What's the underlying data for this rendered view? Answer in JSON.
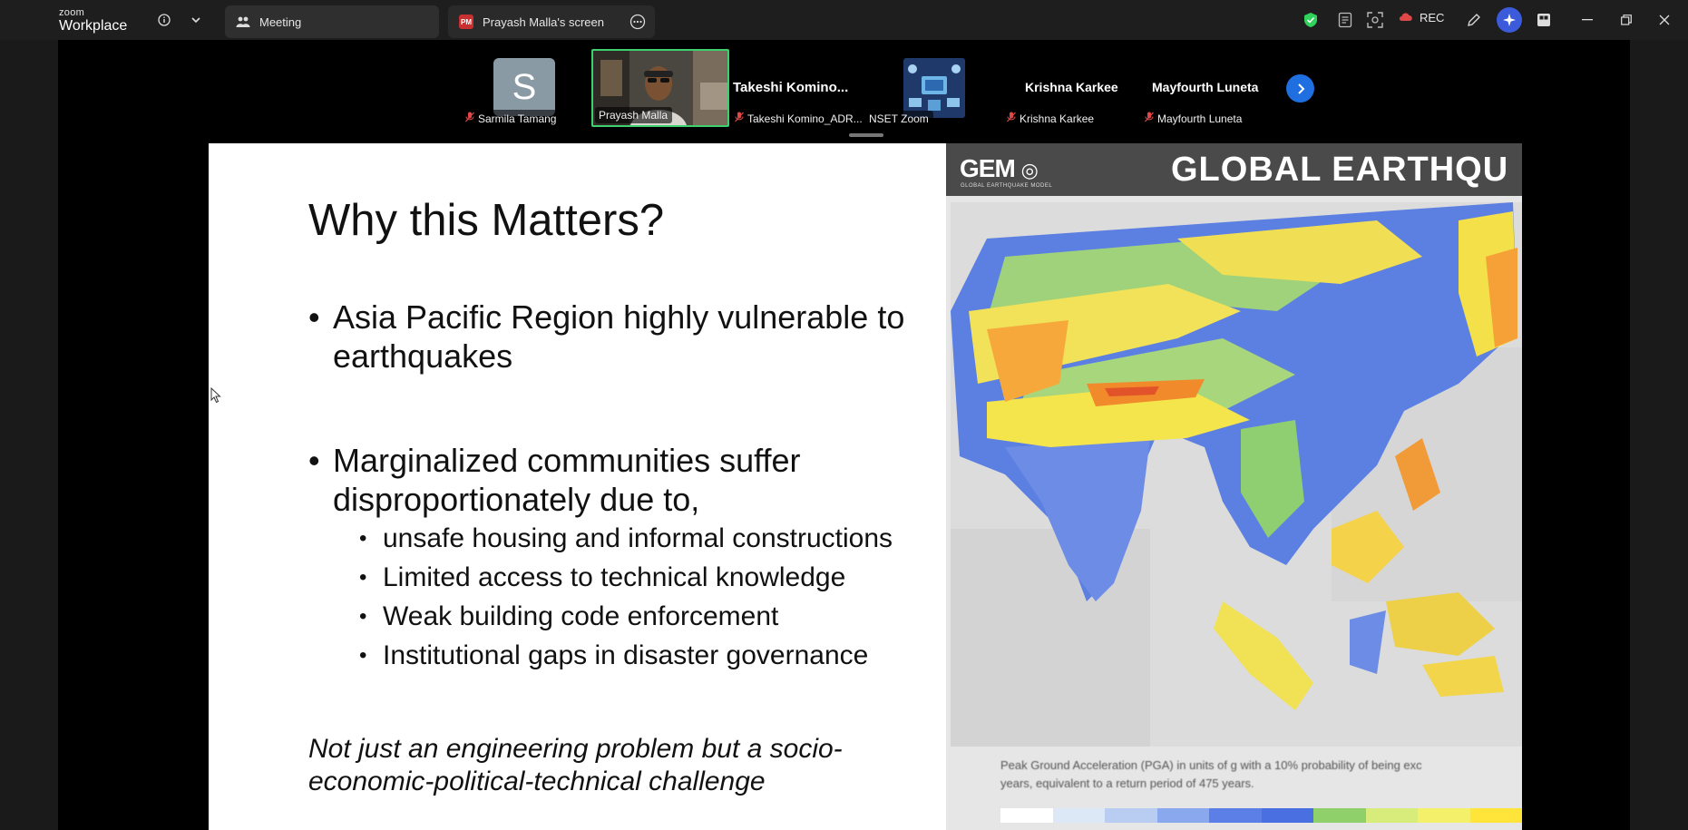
{
  "app": {
    "logo_small": "zoom",
    "logo_big": "Workplace"
  },
  "tabs": [
    {
      "label": "Meeting",
      "icon": "participants-icon"
    },
    {
      "label": "Prayash Malla's screen",
      "badge": "PM"
    }
  ],
  "toolbar": {
    "rec_label": "REC"
  },
  "participants": [
    {
      "name": "Sarmila Tamang",
      "avatar_letter": "S",
      "muted": true
    },
    {
      "name": "Prayash Malla",
      "muted": false,
      "active_speaker": true
    },
    {
      "name": "Takeshi Komino_ADR...",
      "display": "Takeshi  Komino...",
      "muted": true
    },
    {
      "name": "NSET Zoom",
      "muted": false
    },
    {
      "name": "Krishna Karkee",
      "display": "Krishna Karkee",
      "muted": true
    },
    {
      "name": "Mayfourth Luneta",
      "display": "Mayfourth Luneta",
      "muted": true
    }
  ],
  "slide": {
    "title": "Why this Matters?",
    "bullet1_line1": "Asia Pacific Region highly vulnerable to",
    "bullet1_line2": "earthquakes",
    "bullet2_line1": "Marginalized communities suffer",
    "bullet2_line2": "disproportionately due to,",
    "subbullets": [
      "unsafe housing and informal constructions",
      "Limited access to technical knowledge",
      "Weak building code enforcement",
      "Institutional gaps in disaster governance"
    ],
    "note_line1": "Not just an engineering problem but a socio-",
    "note_line2": "economic-political-technical challenge"
  },
  "map": {
    "logo": "GEM",
    "logo_sub": "GLOBAL EARTHQUAKE MODEL",
    "title": "GLOBAL EARTHQU",
    "caption_line1": "Peak Ground Acceleration (PGA) in units of g with a 10% probability of being exc",
    "caption_line2": "years, equivalent to a return period of 475 years.",
    "scale_colors": [
      "#ffffff",
      "#dde8f7",
      "#b9cdf2",
      "#8aa8ee",
      "#5b7fe6",
      "#4a6fe0",
      "#8fd06a",
      "#d7ec7a",
      "#f5f06a",
      "#ffe53a"
    ]
  },
  "colors": {
    "accent": "#1f6fe0",
    "speaker_border": "#3ecf6e",
    "mic_off": "#e04848",
    "shield": "#2fd35b"
  }
}
